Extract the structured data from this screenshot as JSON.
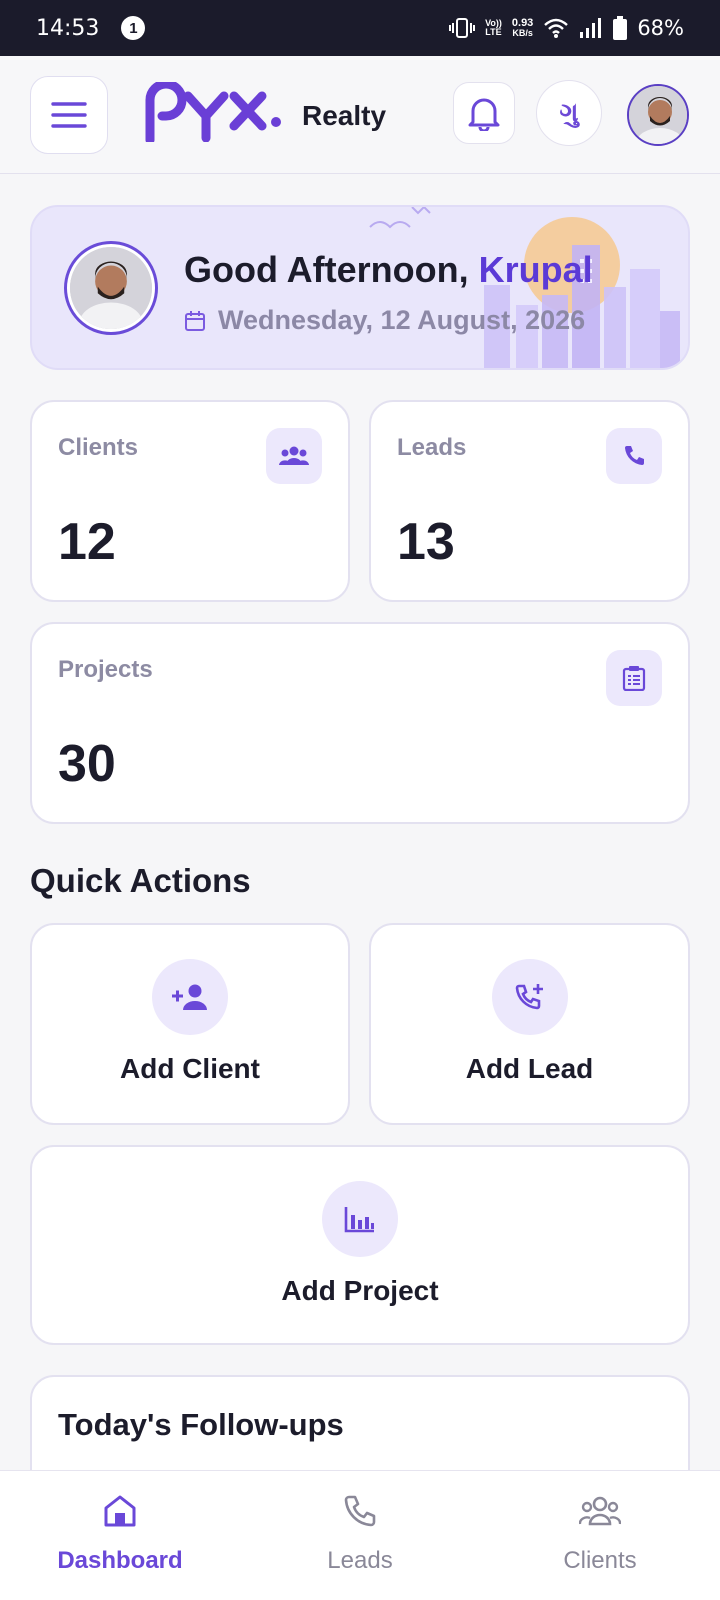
{
  "status_bar": {
    "time": "14:53",
    "notification_count": "1",
    "network_speed_top": "0.93",
    "network_speed_bottom": "KB/s",
    "volte_top": "Vo))",
    "volte_bottom": "LTE",
    "battery": "68%"
  },
  "header": {
    "brand_sub": "Realty",
    "language_glyph": "ગુ"
  },
  "greeting": {
    "prefix": "Good Afternoon, ",
    "name": "Krupal",
    "date": "Wednesday, 12 August, 2026"
  },
  "stats": {
    "clients": {
      "label": "Clients",
      "value": "12"
    },
    "leads": {
      "label": "Leads",
      "value": "13"
    },
    "projects": {
      "label": "Projects",
      "value": "30"
    }
  },
  "quick_actions": {
    "title": "Quick Actions",
    "add_client": "Add Client",
    "add_lead": "Add Lead",
    "add_project": "Add Project"
  },
  "followups": {
    "title": "Today's Follow-ups"
  },
  "bottom_nav": {
    "dashboard": "Dashboard",
    "leads": "Leads",
    "clients": "Clients"
  },
  "colors": {
    "accent": "#6a48d8",
    "status_bar": "#1b1b2b",
    "greeting_bg": "#e9e6fb"
  }
}
